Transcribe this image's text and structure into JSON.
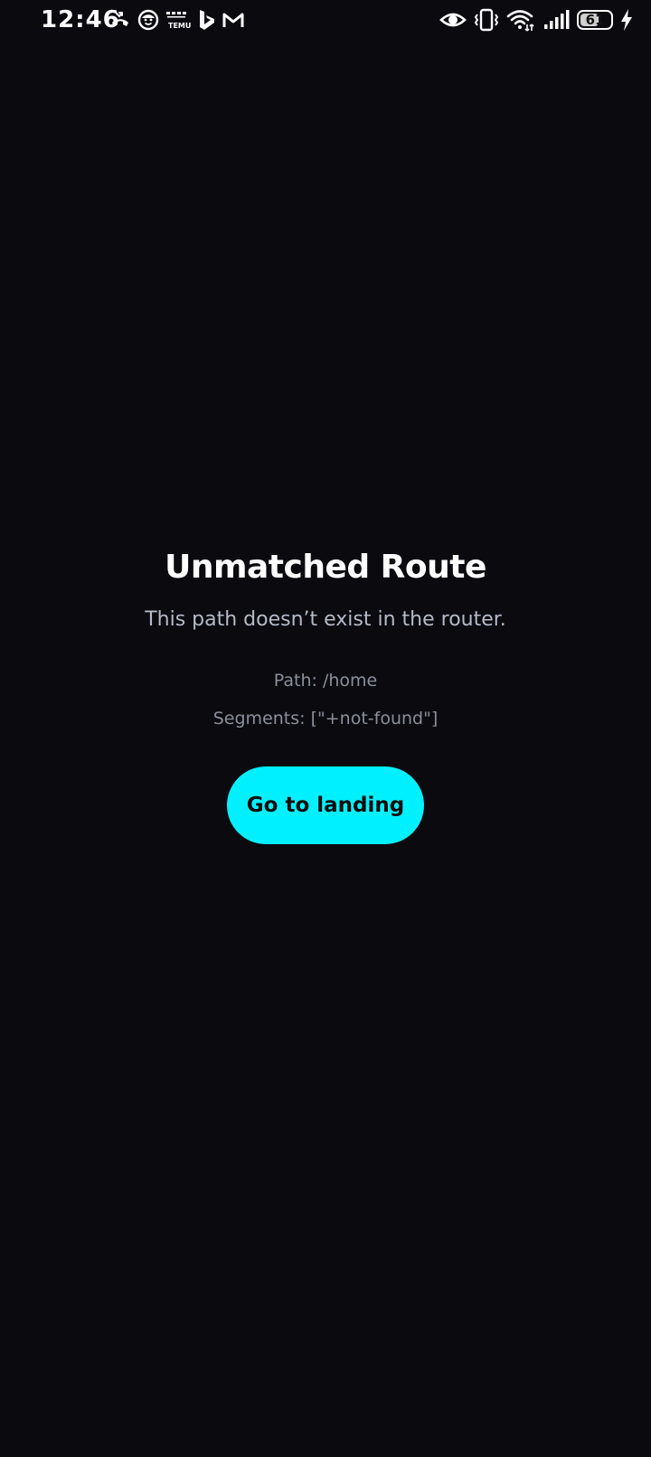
{
  "status_bar": {
    "time": "12:46",
    "temu_label_top": "TEMU",
    "battery_level": 61,
    "battery_text": "61",
    "left_icons": [
      "missed-call-icon",
      "face-emoji-icon",
      "temu-app-icon",
      "bing-icon",
      "gmail-icon"
    ],
    "right_icons": [
      "eye-icon",
      "vibrate-icon",
      "wifi-icon",
      "signal-icon",
      "battery-icon",
      "charging-icon"
    ]
  },
  "page": {
    "title": "Unmatched Route",
    "subtitle": "This path doesn’t exist in the router.",
    "path_line": "Path: /home",
    "segments_line": "Segments: [\"+not-found\"]",
    "button_label": "Go to landing"
  },
  "colors": {
    "background": "#0a0a0f",
    "accent": "#00f0ff",
    "subtitle": "#b4bac8",
    "muted": "#8a8f9c"
  }
}
